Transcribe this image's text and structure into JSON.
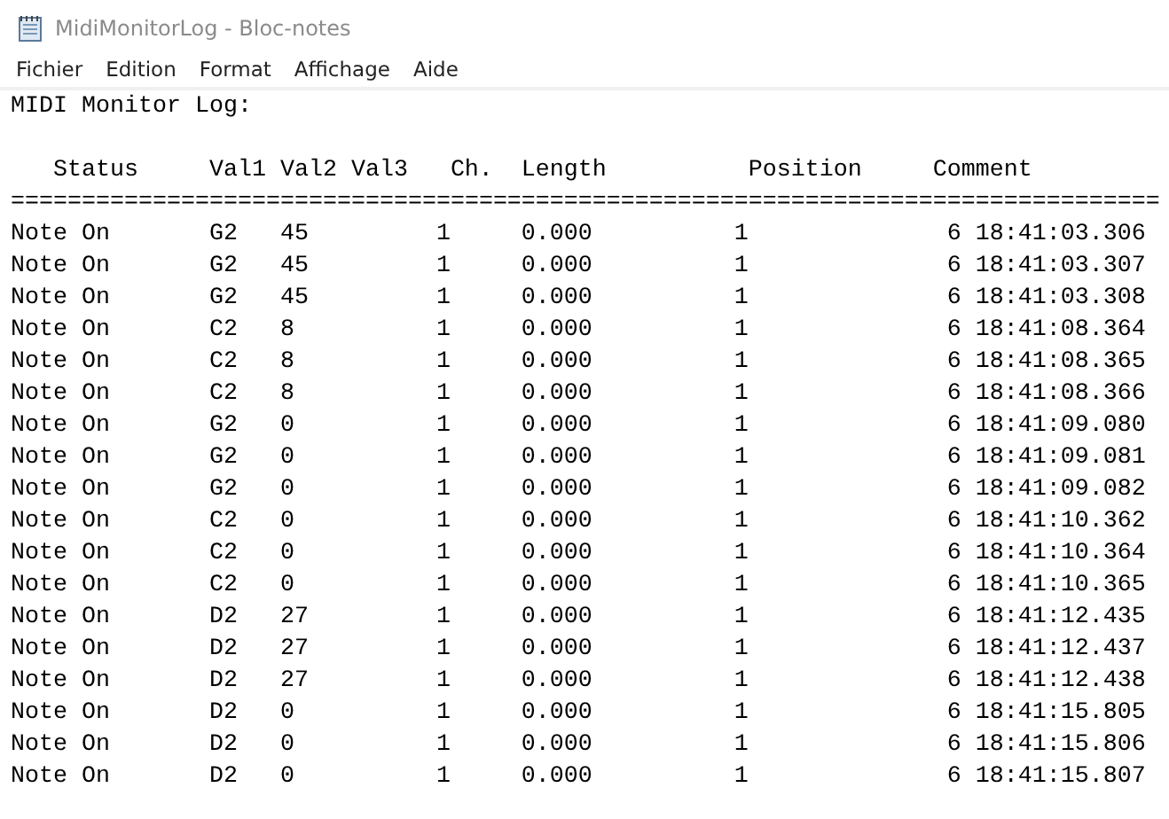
{
  "window": {
    "title": "MidiMonitorLog - Bloc-notes"
  },
  "menu": [
    "Fichier",
    "Edition",
    "Format",
    "Affichage",
    "Aide"
  ],
  "document": {
    "title_line": "MIDI Monitor Log:",
    "columns": [
      "Status",
      "Val1",
      "Val2",
      "Val3",
      "Ch.",
      "Length",
      "Position",
      "Comment"
    ],
    "separator": "=================================================================================",
    "rows": [
      [
        "Note On",
        "G2",
        "45",
        "",
        "1",
        "0.000",
        "1",
        "6 18:41:03.306"
      ],
      [
        "Note On",
        "G2",
        "45",
        "",
        "1",
        "0.000",
        "1",
        "6 18:41:03.307"
      ],
      [
        "Note On",
        "G2",
        "45",
        "",
        "1",
        "0.000",
        "1",
        "6 18:41:03.308"
      ],
      [
        "Note On",
        "C2",
        "8",
        "",
        "1",
        "0.000",
        "1",
        "6 18:41:08.364"
      ],
      [
        "Note On",
        "C2",
        "8",
        "",
        "1",
        "0.000",
        "1",
        "6 18:41:08.365"
      ],
      [
        "Note On",
        "C2",
        "8",
        "",
        "1",
        "0.000",
        "1",
        "6 18:41:08.366"
      ],
      [
        "Note On",
        "G2",
        "0",
        "",
        "1",
        "0.000",
        "1",
        "6 18:41:09.080"
      ],
      [
        "Note On",
        "G2",
        "0",
        "",
        "1",
        "0.000",
        "1",
        "6 18:41:09.081"
      ],
      [
        "Note On",
        "G2",
        "0",
        "",
        "1",
        "0.000",
        "1",
        "6 18:41:09.082"
      ],
      [
        "Note On",
        "C2",
        "0",
        "",
        "1",
        "0.000",
        "1",
        "6 18:41:10.362"
      ],
      [
        "Note On",
        "C2",
        "0",
        "",
        "1",
        "0.000",
        "1",
        "6 18:41:10.364"
      ],
      [
        "Note On",
        "C2",
        "0",
        "",
        "1",
        "0.000",
        "1",
        "6 18:41:10.365"
      ],
      [
        "Note On",
        "D2",
        "27",
        "",
        "1",
        "0.000",
        "1",
        "6 18:41:12.435"
      ],
      [
        "Note On",
        "D2",
        "27",
        "",
        "1",
        "0.000",
        "1",
        "6 18:41:12.437"
      ],
      [
        "Note On",
        "D2",
        "27",
        "",
        "1",
        "0.000",
        "1",
        "6 18:41:12.438"
      ],
      [
        "Note On",
        "D2",
        "0",
        "",
        "1",
        "0.000",
        "1",
        "6 18:41:15.805"
      ],
      [
        "Note On",
        "D2",
        "0",
        "",
        "1",
        "0.000",
        "1",
        "6 18:41:15.806"
      ],
      [
        "Note On",
        "D2",
        "0",
        "",
        "1",
        "0.000",
        "1",
        "6 18:41:15.807"
      ]
    ]
  }
}
